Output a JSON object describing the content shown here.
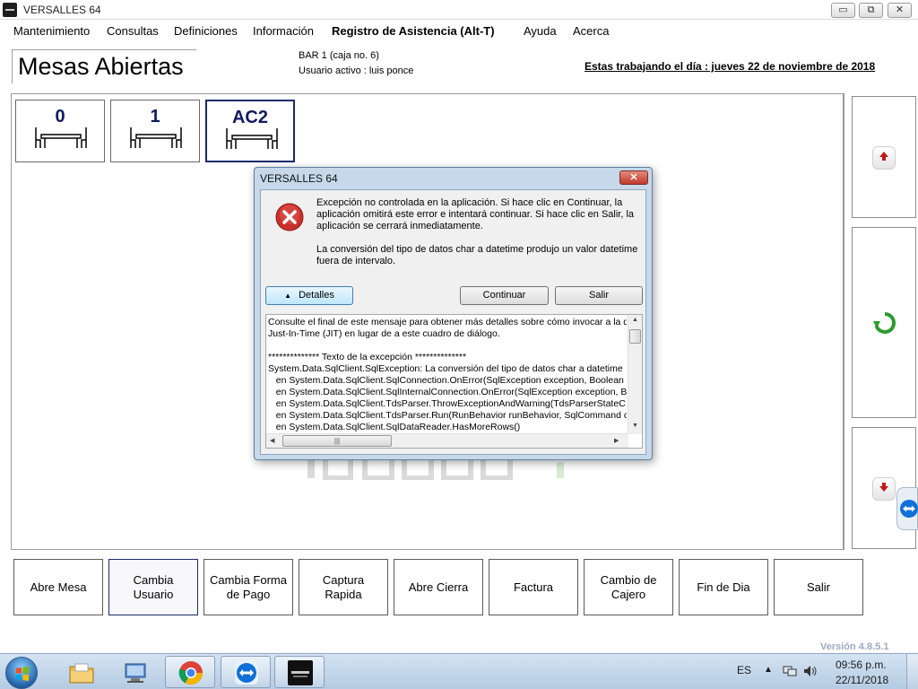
{
  "window": {
    "title": "VERSALLES 64",
    "min_glyph": "▭",
    "max_glyph": "⧉",
    "close_glyph": "✕"
  },
  "menu": [
    {
      "label": "Mantenimiento"
    },
    {
      "label": "Consultas"
    },
    {
      "label": "Definiciones"
    },
    {
      "label": "Información"
    },
    {
      "label": "Registro de Asistencia (Alt-T)"
    },
    {
      "label": "Ayuda"
    },
    {
      "label": "Acerca"
    }
  ],
  "header": {
    "title": "Mesas Abiertas",
    "caja": "BAR 1 (caja no. 6)",
    "usuario": "Usuario activo : luis  ponce",
    "fecha": "Estas trabajando el día : jueves 22 de noviembre de 2018"
  },
  "mesas": [
    {
      "number": "0",
      "selected": false
    },
    {
      "number": "1",
      "selected": false
    },
    {
      "number": "AC2",
      "selected": true
    }
  ],
  "side_buttons": [
    {
      "icon": "scroll-up-icon"
    },
    {
      "icon": "refresh-icon"
    },
    {
      "icon": "scroll-down-icon"
    }
  ],
  "bottom_buttons": [
    {
      "label": "Abre Mesa",
      "active": false
    },
    {
      "label": "Cambia Usuario",
      "active": true
    },
    {
      "label": "Cambia Forma de Pago",
      "active": false
    },
    {
      "label": "Captura Rapida",
      "active": false
    },
    {
      "label": "Abre Cierra",
      "active": false
    },
    {
      "label": "Factura",
      "active": false
    },
    {
      "label": "Cambio de Cajero",
      "active": false
    },
    {
      "label": "Fin de Dia",
      "active": false
    },
    {
      "label": "Salir",
      "active": false
    }
  ],
  "version": "Versión 4.8.5.1",
  "dialog": {
    "title": "VERSALLES 64",
    "close_glyph": "✕",
    "icon": "error-icon",
    "message": "Excepción no controlada en la aplicación. Si hace clic en Continuar, la aplicación omitirá este error e intentará continuar. Si hace clic en Salir, la aplicación se cerrará inmediatamente.",
    "detail_message": "La conversión del tipo de datos char a datetime produjo un valor datetime fuera de intervalo.",
    "buttons": {
      "details": "Detalles",
      "details_glyph": "▲",
      "continue": "Continuar",
      "exit": "Salir"
    },
    "details_text": "Consulte el final de este mensaje para obtener más detalles sobre cómo invocar a la d\nJust-In-Time (JIT) en lugar de a este cuadro de diálogo.\n\n************** Texto de la excepción **************\nSystem.Data.SqlClient.SqlException: La conversión del tipo de datos char a datetime\n   en System.Data.SqlClient.SqlConnection.OnError(SqlException exception, Boolean\n   en System.Data.SqlClient.SqlInternalConnection.OnError(SqlException exception, B\n   en System.Data.SqlClient.TdsParser.ThrowExceptionAndWarning(TdsParserStateC\n   en System.Data.SqlClient.TdsParser.Run(RunBehavior runBehavior, SqlCommand c\n   en System.Data.SqlClient.SqlDataReader.HasMoreRows()"
  },
  "taskbar": {
    "apps": [
      {
        "name": "explorer",
        "icon": "folder-icon",
        "open": false
      },
      {
        "name": "remote desktop",
        "icon": "remote-desktop-icon",
        "open": false
      },
      {
        "name": "chrome",
        "icon": "chrome-icon",
        "open": true
      },
      {
        "name": "teamviewer",
        "icon": "teamviewer-icon",
        "open": true
      },
      {
        "name": "versalles",
        "icon": "versalles-icon",
        "open": true
      }
    ],
    "language": "ES",
    "tray_arrow": "▲",
    "time": "09:56 p.m.",
    "date": "22/11/2018"
  },
  "colors": {
    "mesa_number": "#101a60",
    "selected_border": "#1a2b6b",
    "dialog_frame": "#c6d8ea",
    "taskbar": "#c3d6ea",
    "version_text": "#9aaac2"
  }
}
